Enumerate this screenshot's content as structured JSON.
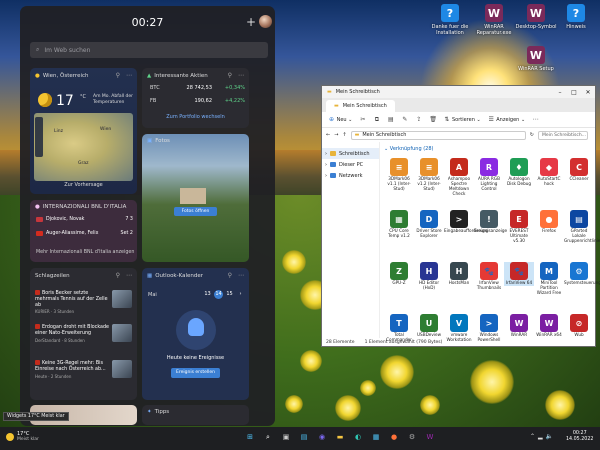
{
  "desktop": {
    "icons": [
      {
        "label": "Danke fuer die Installation",
        "color": "#1e88e5",
        "glyph": "?"
      },
      {
        "label": "WinRAR Reparatur.exe",
        "color": "#7a2a5a",
        "glyph": "W"
      },
      {
        "label": "Desktop-Symbol",
        "color": "#7a2a5a",
        "glyph": "W"
      },
      {
        "label": "Hinweis",
        "color": "#1e88e5",
        "glyph": "?"
      },
      {
        "label": "WinRAR Setup",
        "color": "#7a2a5a",
        "glyph": "W"
      }
    ]
  },
  "widgets": {
    "time": "00:27",
    "search_placeholder": "Im Web suchen",
    "weather": {
      "location": "Wien, Österreich",
      "temp": "17",
      "unit": "°C",
      "summary": "Am Mo. Abfall der Temperaturen",
      "cities": [
        "Wien",
        "Graz",
        "Linz"
      ],
      "forecast_link": "Zur Vorhersage"
    },
    "stocks": {
      "title": "Interessante Aktien",
      "rows": [
        {
          "symbol": "BTC",
          "value": "28 742,53",
          "change": "+0,34%"
        },
        {
          "symbol": "FB",
          "value": "190,62",
          "change": "+4,22%"
        }
      ],
      "link": "Zum Portfolio wechseln"
    },
    "photos": {
      "title": "Fotos",
      "button": "Fotos öffnen"
    },
    "sports": {
      "title": "INTERNAZIONALI BNL D'ITALIA",
      "matches": [
        {
          "player": "Djokovic, Novak",
          "score": "7 3",
          "flag": "#c6363c"
        },
        {
          "player": "Auger-Aliassime, Felix",
          "score": "Set 2",
          "flag": "#d52b1e"
        }
      ],
      "link": "Mehr Internazionali BNL d'Italia anzeigen"
    },
    "news": {
      "title": "Schlagzeilen",
      "items": [
        {
          "headline": "Boris Becker setzte mehrmals Tennis auf der Zelle ab",
          "source": "KURIER · 3 Stunden"
        },
        {
          "headline": "Erdogan droht mit Blockade einer Nato-Erweiterung",
          "source": "DerStandard · 8 Stunden"
        },
        {
          "headline": "Keine 3G-Regel mehr: Bis Einreise nach Österreich ab...",
          "source": "Heute · 2 Stunden"
        }
      ]
    },
    "calendar": {
      "title": "Outlook-Kalender",
      "month": "Mai",
      "days": [
        "13",
        "14",
        "15"
      ],
      "selected_day": "14",
      "empty_text": "Heute keine Ereignisse",
      "button": "Ereignis erstellen"
    },
    "tips": {
      "title": "Tipps"
    }
  },
  "tooltip": "Widgets 17°C Meist klar",
  "explorer": {
    "window_title": "Mein Schreibtisch",
    "tab_label": "Mein Schreibtisch",
    "toolbar": {
      "new": "Neu",
      "sort": "Sortieren",
      "view": "Anzeigen"
    },
    "address": "Mein Schreibtisch",
    "search_placeholder": "Mein Schreibtisch...",
    "nav": [
      {
        "label": "Schreibtisch",
        "color": "#e8b43a"
      },
      {
        "label": "Dieser PC",
        "color": "#3b7fd3"
      },
      {
        "label": "Netzwerk",
        "color": "#3b7fd3"
      }
    ],
    "group_label": "Verknüpfung (28)",
    "files": [
      {
        "label": "3DMark06 v1.1 (Inter-Stud)",
        "color": "#e8902a",
        "glyph": "≡"
      },
      {
        "label": "3DMark06 v1.2 (Inter-Stud)",
        "color": "#e8902a",
        "glyph": "≡"
      },
      {
        "label": "Ashampoo Spectre Meltdown Check",
        "color": "#c42b1c",
        "glyph": "A"
      },
      {
        "label": "AURA RGB Lighting Control",
        "color": "#8a2be2",
        "glyph": "R"
      },
      {
        "label": "Autologon Disk Debug",
        "color": "#1f9d55",
        "glyph": "♦"
      },
      {
        "label": "AutoStartC hock",
        "color": "#e63946",
        "glyph": "◆"
      },
      {
        "label": "CCleaner",
        "color": "#d32f2f",
        "glyph": "C"
      },
      {
        "label": "CPU Core Temp v1.2",
        "color": "#2e7d32",
        "glyph": "▦"
      },
      {
        "label": "Driver Store Explorer",
        "color": "#1565c0",
        "glyph": "D"
      },
      {
        "label": "Eingabeaufforderung",
        "color": "#222222",
        "glyph": ">"
      },
      {
        "label": "Ereignisanzeige",
        "color": "#455a64",
        "glyph": "!"
      },
      {
        "label": "EVEREST Ultimate v5.30",
        "color": "#c62828",
        "glyph": "E"
      },
      {
        "label": "Firefox",
        "color": "#ff7139",
        "glyph": "●"
      },
      {
        "label": "GParted Lokale Gruppenrichtlinien",
        "color": "#0d47a1",
        "glyph": "▤"
      },
      {
        "label": "GPU-Z",
        "color": "#2e7d32",
        "glyph": "Z"
      },
      {
        "label": "HD Editor (HxD)",
        "color": "#283593",
        "glyph": "H"
      },
      {
        "label": "HostsMan",
        "color": "#37474f",
        "glyph": "H"
      },
      {
        "label": "IrfanView Thumbnails",
        "color": "#e53935",
        "glyph": "🐾"
      },
      {
        "label": "IrfanView 64",
        "color": "#c62828",
        "glyph": "🐾"
      },
      {
        "label": "MiniTool Partition Wizard Free",
        "color": "#1565c0",
        "glyph": "M"
      },
      {
        "label": "Systemsteuerung",
        "color": "#1976d2",
        "glyph": "⚙"
      },
      {
        "label": "Total Commander",
        "color": "#1565c0",
        "glyph": "T"
      },
      {
        "label": "USBDeview",
        "color": "#2e7d32",
        "glyph": "U"
      },
      {
        "label": "vmware Workstation",
        "color": "#0277bd",
        "glyph": "V"
      },
      {
        "label": "Windows PowerShell",
        "color": "#1565c0",
        "glyph": ">"
      },
      {
        "label": "WinRAR",
        "color": "#7b1fa2",
        "glyph": "W"
      },
      {
        "label": "WinRAR x64",
        "color": "#7b1fa2",
        "glyph": "W"
      },
      {
        "label": "Wub",
        "color": "#c62828",
        "glyph": "⊘"
      }
    ],
    "selected_file": "IrfanView 64",
    "status": {
      "count": "28 Elemente",
      "selection": "1 Element ausgewählt (790 Bytes)"
    }
  },
  "taskbar": {
    "weather_temp": "17°C",
    "weather_desc": "Meist klar",
    "apps": [
      {
        "name": "start-icon",
        "color": "#4fc3f7",
        "glyph": "⊞"
      },
      {
        "name": "search-icon",
        "color": "#ffffff",
        "glyph": "⌕"
      },
      {
        "name": "task-view-icon",
        "color": "#cccccc",
        "glyph": "▣"
      },
      {
        "name": "widgets-icon",
        "color": "#4fc3f7",
        "glyph": "▤"
      },
      {
        "name": "chat-icon",
        "color": "#7b68ee",
        "glyph": "◉"
      },
      {
        "name": "explorer-icon",
        "color": "#f5c542",
        "glyph": "▬"
      },
      {
        "name": "edge-icon",
        "color": "#2fc4b2",
        "glyph": "◐"
      },
      {
        "name": "store-icon",
        "color": "#4fc3f7",
        "glyph": "▦"
      },
      {
        "name": "firefox-icon",
        "color": "#ff7139",
        "glyph": "●"
      },
      {
        "name": "settings-icon",
        "color": "#aaaaaa",
        "glyph": "⚙"
      },
      {
        "name": "winrar-icon",
        "color": "#9c27b0",
        "glyph": "W"
      }
    ],
    "time": "00:27",
    "date": "14.05.2022"
  }
}
